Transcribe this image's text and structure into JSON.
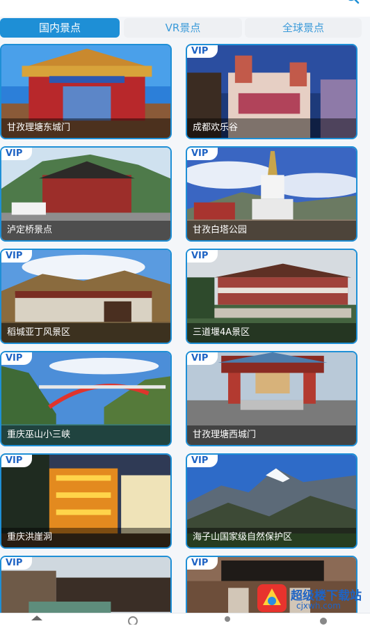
{
  "header": {
    "title": "",
    "search_icon": "search-icon"
  },
  "tabs": [
    {
      "label": "国内景点",
      "active": true
    },
    {
      "label": "VR景点",
      "active": false
    },
    {
      "label": "全球景点",
      "active": false
    }
  ],
  "cards": [
    {
      "name": "甘孜理塘东城门",
      "vip": false,
      "badge": ""
    },
    {
      "name": "成都欢乐谷",
      "vip": true,
      "badge": "VIP"
    },
    {
      "name": "泸定桥景点",
      "vip": true,
      "badge": "VIP"
    },
    {
      "name": "甘孜白塔公园",
      "vip": true,
      "badge": "VIP"
    },
    {
      "name": "稻城亚丁风景区",
      "vip": true,
      "badge": "VIP"
    },
    {
      "name": "三道堰4A景区",
      "vip": true,
      "badge": "VIP"
    },
    {
      "name": "重庆巫山小三峡",
      "vip": true,
      "badge": "VIP"
    },
    {
      "name": "甘孜理塘西城门",
      "vip": true,
      "badge": "VIP"
    },
    {
      "name": "重庆洪崖洞",
      "vip": true,
      "badge": "VIP"
    },
    {
      "name": "海子山国家级自然保护区",
      "vip": true,
      "badge": "VIP"
    },
    {
      "name": "",
      "vip": true,
      "badge": "VIP"
    },
    {
      "name": "",
      "vip": true,
      "badge": "VIP"
    }
  ],
  "watermark": {
    "title": "超级楼下载站",
    "url": "cjxwh.com"
  },
  "colors": {
    "accent": "#1e8fd6",
    "vip_text": "#1e63c4"
  }
}
